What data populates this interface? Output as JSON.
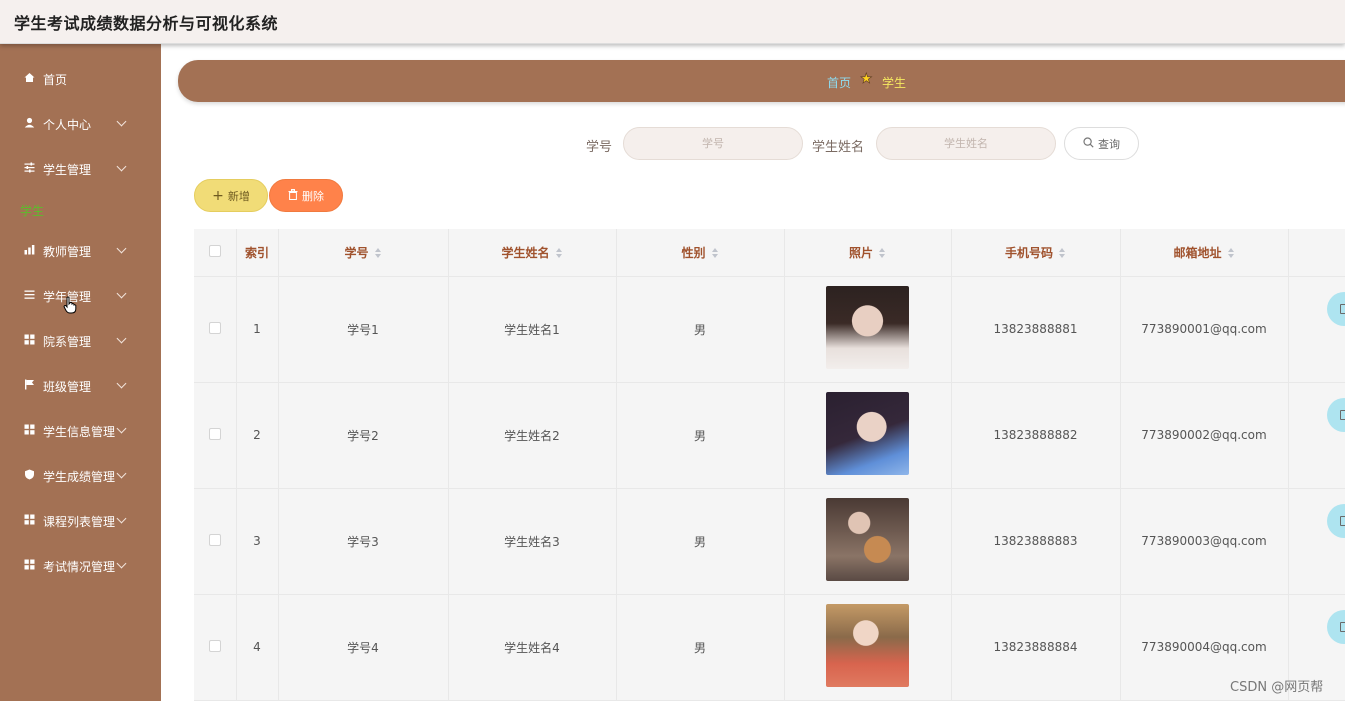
{
  "app": {
    "title": "学生考试成绩数据分析与可视化系统"
  },
  "sidebar": {
    "items": [
      {
        "label": "首页",
        "icon": "home-icon"
      },
      {
        "label": "个人中心",
        "icon": "user-icon"
      },
      {
        "label": "学生管理",
        "icon": "sliders-icon"
      },
      {
        "label": "教师管理",
        "icon": "chart-icon"
      },
      {
        "label": "学年管理",
        "icon": "list-icon"
      },
      {
        "label": "院系管理",
        "icon": "grid-icon"
      },
      {
        "label": "班级管理",
        "icon": "flag-icon"
      },
      {
        "label": "学生信息管理",
        "icon": "grid-icon"
      },
      {
        "label": "学生成绩管理",
        "icon": "shield-icon"
      },
      {
        "label": "课程列表管理",
        "icon": "grid-icon"
      },
      {
        "label": "考试情况管理",
        "icon": "grid-icon"
      }
    ],
    "sub_item": "学生"
  },
  "breadcrumb": {
    "home": "首页",
    "current": "学生"
  },
  "search": {
    "field1_label": "学号",
    "field1_placeholder": "学号",
    "field2_label": "学生姓名",
    "field2_placeholder": "学生姓名",
    "query_label": "查询"
  },
  "actions": {
    "add_label": "新增",
    "delete_label": "删除"
  },
  "table": {
    "columns": [
      "索引",
      "学号",
      "学生姓名",
      "性别",
      "照片",
      "手机号码",
      "邮箱地址"
    ],
    "rows": [
      {
        "index": "1",
        "id": "学号1",
        "name": "学生姓名1",
        "gender": "男",
        "phone": "13823888881",
        "email": "773890001@qq.com"
      },
      {
        "index": "2",
        "id": "学号2",
        "name": "学生姓名2",
        "gender": "男",
        "phone": "13823888882",
        "email": "773890002@qq.com"
      },
      {
        "index": "3",
        "id": "学号3",
        "name": "学生姓名3",
        "gender": "男",
        "phone": "13823888883",
        "email": "773890003@qq.com"
      },
      {
        "index": "4",
        "id": "学号4",
        "name": "学生姓名4",
        "gender": "男",
        "phone": "13823888884",
        "email": "773890004@qq.com"
      }
    ]
  },
  "watermark": "CSDN @网页帮",
  "colors": {
    "sidebar": "#a37154",
    "accent_green": "#5cbd2c",
    "add_button": "#f1dc77",
    "delete_button": "#ff824a",
    "header_text": "#a0522d"
  }
}
